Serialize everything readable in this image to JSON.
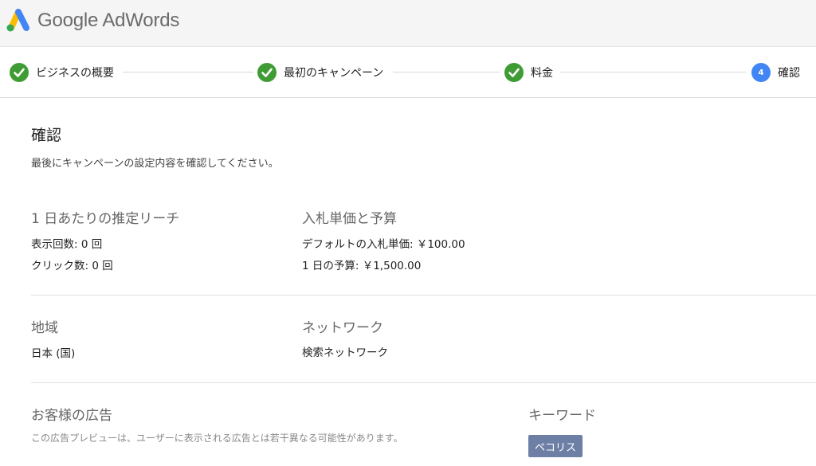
{
  "header": {
    "logo_text": "Google AdWords",
    "logo_icon": "adwords-logo",
    "colors": {
      "blue": "#4285f4",
      "green": "#34a853",
      "yellow": "#fbbc05"
    }
  },
  "stepper": {
    "steps": [
      {
        "label": "ビジネスの概要",
        "state": "done",
        "icon": "check-circle-icon"
      },
      {
        "label": "最初のキャンペーン",
        "state": "done",
        "icon": "check-circle-icon"
      },
      {
        "label": "料金",
        "state": "done",
        "icon": "check-circle-icon"
      },
      {
        "label": "確認",
        "state": "current",
        "number": "4"
      }
    ],
    "colors": {
      "done": "#3f9c35",
      "current": "#4285f4"
    }
  },
  "main": {
    "title": "確認",
    "description": "最後にキャンペーンの設定内容を確認してください。",
    "reach": {
      "title": "1 日あたりの推定リーチ",
      "impressions": "表示回数: 0 回",
      "clicks": "クリック数: 0 回"
    },
    "bidding": {
      "title": "入札単価と予算",
      "default_bid": "デフォルトの入札単価: ￥100.00",
      "daily_budget": "1 日の予算: ￥1,500.00"
    },
    "location": {
      "title": "地域",
      "value": "日本 (国)"
    },
    "network": {
      "title": "ネットワーク",
      "value": "検索ネットワーク"
    },
    "ads": {
      "title": "お客様の広告",
      "note": "この広告プレビューは、ユーザーに表示される広告とは若干異なる可能性があります。"
    },
    "keywords": {
      "title": "キーワード",
      "items": [
        "ペコリス"
      ],
      "chip_color": "#6e7fa6"
    }
  }
}
